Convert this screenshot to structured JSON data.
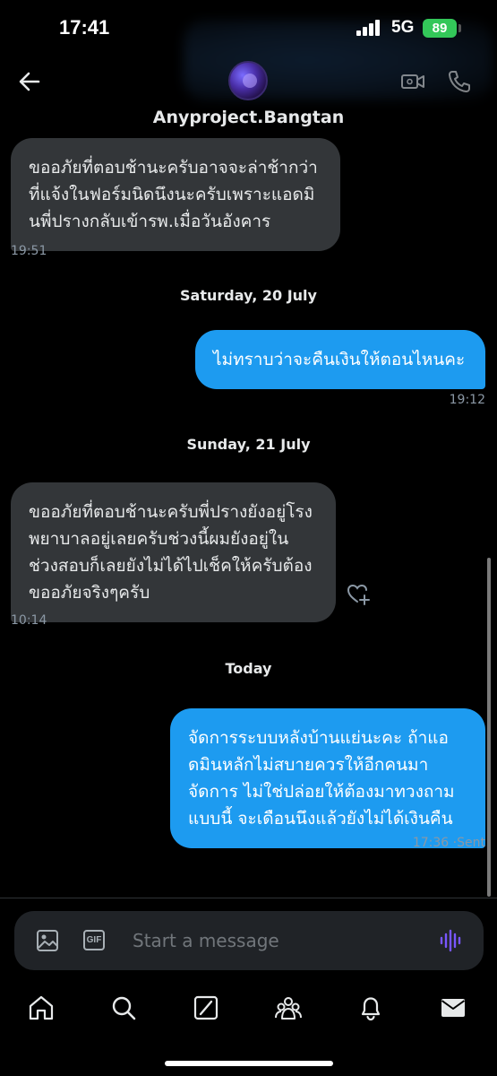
{
  "status_bar": {
    "time": "17:41",
    "network": "5G",
    "battery": "89"
  },
  "header": {
    "contact_name": "Anyproject.Bangtan",
    "icons": [
      "back-arrow-icon",
      "video-call-icon",
      "phone-icon"
    ]
  },
  "messages": [
    {
      "direction": "in",
      "text": "ขออภัยที่ตอบช้านะครับอาจจะล่าช้ากว่าที่แจ้งในฟอร์มนิดนึงนะครับเพราะแอดมินพี่ปรางกลับเข้ารพ.เมื่อวันอังคาร",
      "time": "19:51"
    },
    {
      "separator": "Saturday, 20 July"
    },
    {
      "direction": "out",
      "text": "ไม่ทราบว่าจะคืนเงินให้ตอนไหนคะ",
      "time": "19:12"
    },
    {
      "separator": "Sunday, 21 July"
    },
    {
      "direction": "in",
      "text": "ขออภัยที่ตอบช้านะครับพี่ปรางยังอยู่โรงพยาบาลอยู่เลยครับช่วงนี้ผมยังอยู่ในช่วงสอบก็เลยยังไม่ได้ไปเช็คให้ครับต้องขออภัยจริงๆครับ",
      "time": "10:14"
    },
    {
      "separator": "Today"
    },
    {
      "direction": "out",
      "text": "จัดการระบบหลังบ้านแย่นะคะ ถ้าแอดมินหลักไม่สบายควรให้อีกคนมาจัดการ ไม่ใช่ปล่อยให้ต้องมาทวงถามแบบนี้ จะเดือนนึงแล้วยังไม่ได้เงินคืน",
      "time": "17:36",
      "status": "Sent"
    }
  ],
  "composer": {
    "placeholder": "Start a message",
    "gif_label": "GIF"
  },
  "bottom_nav": [
    "home-icon",
    "search-icon",
    "grok-icon",
    "communities-icon",
    "notifications-icon",
    "messages-icon"
  ],
  "colors": {
    "outgoing_bubble": "#1d9bf0",
    "incoming_bubble": "#333639",
    "battery": "#33c759",
    "voice_accent": "#7856ff"
  }
}
